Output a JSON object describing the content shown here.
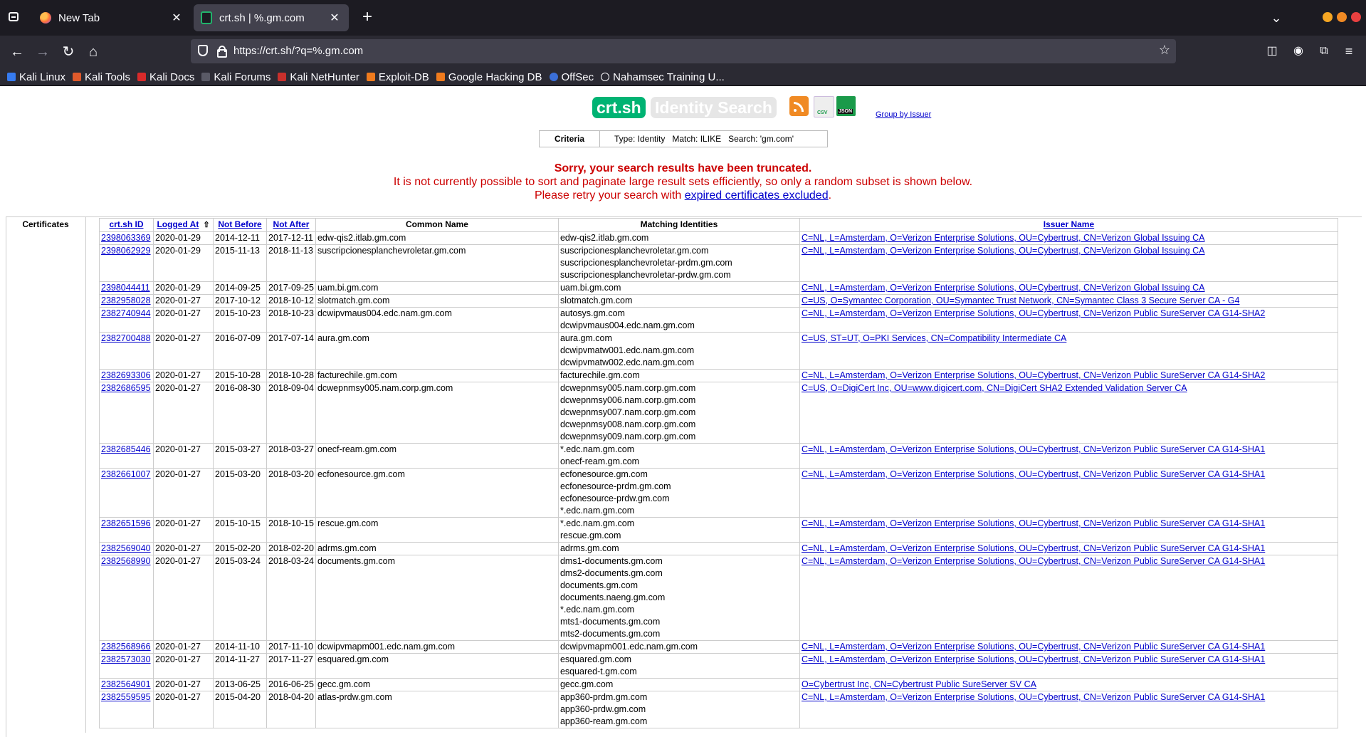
{
  "browser": {
    "tabs": [
      {
        "title": "New Tab",
        "active": false
      },
      {
        "title": "crt.sh | %.gm.com",
        "active": true
      }
    ],
    "url": "https://crt.sh/?q=%.gm.com",
    "bookmarks": [
      {
        "label": "Kali Linux",
        "icon": "kali-dragon-icon"
      },
      {
        "label": "Kali Tools",
        "icon": "kali-tools-icon"
      },
      {
        "label": "Kali Docs",
        "icon": "kali-docs-icon"
      },
      {
        "label": "Kali Forums",
        "icon": "kali-forums-icon"
      },
      {
        "label": "Kali NetHunter",
        "icon": "kali-nethunter-icon"
      },
      {
        "label": "Exploit-DB",
        "icon": "exploit-db-icon"
      },
      {
        "label": "Google Hacking DB",
        "icon": "ghdb-icon"
      },
      {
        "label": "OffSec",
        "icon": "offsec-icon"
      },
      {
        "label": "Nahamsec Training U...",
        "icon": "globe-icon"
      }
    ],
    "accent": "#1c1b22"
  },
  "page": {
    "logo": "crt.sh",
    "heading": "Identity Search",
    "group_by_issuer": "Group by Issuer",
    "criteria": {
      "label": "Criteria",
      "text": "Type: Identity   Match: ILIKE   Search: 'gm.com'"
    },
    "warning": {
      "line1": "Sorry, your search results have been truncated.",
      "line2": "It is not currently possible to sort and paginate large result sets efficiently, so only a random subset is shown below.",
      "line3_prefix": "Please retry your search with ",
      "line3_link": "expired certificates excluded",
      "line3_suffix": "."
    },
    "section_label": "Certificates",
    "columns": [
      "crt.sh ID",
      "Logged At",
      "Not Before",
      "Not After",
      "Common Name",
      "Matching Identities",
      "Issuer Name"
    ],
    "sort_indicator": "⇧",
    "rows": [
      {
        "id": "2398063369",
        "logged": "2020-01-29",
        "not_before": "2014-12-11",
        "not_after": "2017-12-11",
        "cn": "edw-qis2.itlab.gm.com",
        "identities": [
          "edw-qis2.itlab.gm.com"
        ],
        "issuer": "C=NL, L=Amsterdam, O=Verizon Enterprise Solutions, OU=Cybertrust, CN=Verizon Global Issuing CA"
      },
      {
        "id": "2398062929",
        "logged": "2020-01-29",
        "not_before": "2015-11-13",
        "not_after": "2018-11-13",
        "cn": "suscripcionesplanchevroletar.gm.com",
        "identities": [
          "suscripcionesplanchevroletar.gm.com",
          "suscripcionesplanchevroletar-prdm.gm.com",
          "suscripcionesplanchevroletar-prdw.gm.com"
        ],
        "issuer": "C=NL, L=Amsterdam, O=Verizon Enterprise Solutions, OU=Cybertrust, CN=Verizon Global Issuing CA"
      },
      {
        "id": "2398044411",
        "logged": "2020-01-29",
        "not_before": "2014-09-25",
        "not_after": "2017-09-25",
        "cn": "uam.bi.gm.com",
        "identities": [
          "uam.bi.gm.com"
        ],
        "issuer": "C=NL, L=Amsterdam, O=Verizon Enterprise Solutions, OU=Cybertrust, CN=Verizon Global Issuing CA"
      },
      {
        "id": "2382958028",
        "logged": "2020-01-27",
        "not_before": "2017-10-12",
        "not_after": "2018-10-12",
        "cn": "slotmatch.gm.com",
        "identities": [
          "slotmatch.gm.com"
        ],
        "issuer": "C=US, O=Symantec Corporation, OU=Symantec Trust Network, CN=Symantec Class 3 Secure Server CA - G4"
      },
      {
        "id": "2382740944",
        "logged": "2020-01-27",
        "not_before": "2015-10-23",
        "not_after": "2018-10-23",
        "cn": "dcwipvmaus004.edc.nam.gm.com",
        "identities": [
          "autosys.gm.com",
          "dcwipvmaus004.edc.nam.gm.com"
        ],
        "issuer": "C=NL, L=Amsterdam, O=Verizon Enterprise Solutions, OU=Cybertrust, CN=Verizon Public SureServer CA G14-SHA2"
      },
      {
        "id": "2382700488",
        "logged": "2020-01-27",
        "not_before": "2016-07-09",
        "not_after": "2017-07-14",
        "cn": "aura.gm.com",
        "identities": [
          "aura.gm.com",
          "dcwipvmatw001.edc.nam.gm.com",
          "dcwipvmatw002.edc.nam.gm.com"
        ],
        "issuer": "C=US, ST=UT, O=PKI Services, CN=Compatibility Intermediate CA"
      },
      {
        "id": "2382693306",
        "logged": "2020-01-27",
        "not_before": "2015-10-28",
        "not_after": "2018-10-28",
        "cn": "facturechile.gm.com",
        "identities": [
          "facturechile.gm.com"
        ],
        "issuer": "C=NL, L=Amsterdam, O=Verizon Enterprise Solutions, OU=Cybertrust, CN=Verizon Public SureServer CA G14-SHA2"
      },
      {
        "id": "2382686595",
        "logged": "2020-01-27",
        "not_before": "2016-08-30",
        "not_after": "2018-09-04",
        "cn": "dcwepnmsy005.nam.corp.gm.com",
        "identities": [
          "dcwepnmsy005.nam.corp.gm.com",
          "dcwepnmsy006.nam.corp.gm.com",
          "dcwepnmsy007.nam.corp.gm.com",
          "dcwepnmsy008.nam.corp.gm.com",
          "dcwepnmsy009.nam.corp.gm.com"
        ],
        "issuer": "C=US, O=DigiCert Inc, OU=www.digicert.com, CN=DigiCert SHA2 Extended Validation Server CA"
      },
      {
        "id": "2382685446",
        "logged": "2020-01-27",
        "not_before": "2015-03-27",
        "not_after": "2018-03-27",
        "cn": "onecf-ream.gm.com",
        "identities": [
          "*.edc.nam.gm.com",
          "onecf-ream.gm.com"
        ],
        "issuer": "C=NL, L=Amsterdam, O=Verizon Enterprise Solutions, OU=Cybertrust, CN=Verizon Public SureServer CA G14-SHA1"
      },
      {
        "id": "2382661007",
        "logged": "2020-01-27",
        "not_before": "2015-03-20",
        "not_after": "2018-03-20",
        "cn": "ecfonesource.gm.com",
        "identities": [
          "ecfonesource.gm.com",
          "ecfonesource-prdm.gm.com",
          "ecfonesource-prdw.gm.com",
          "*.edc.nam.gm.com"
        ],
        "issuer": "C=NL, L=Amsterdam, O=Verizon Enterprise Solutions, OU=Cybertrust, CN=Verizon Public SureServer CA G14-SHA1"
      },
      {
        "id": "2382651596",
        "logged": "2020-01-27",
        "not_before": "2015-10-15",
        "not_after": "2018-10-15",
        "cn": "rescue.gm.com",
        "identities": [
          "*.edc.nam.gm.com",
          "rescue.gm.com"
        ],
        "issuer": "C=NL, L=Amsterdam, O=Verizon Enterprise Solutions, OU=Cybertrust, CN=Verizon Public SureServer CA G14-SHA1"
      },
      {
        "id": "2382569040",
        "logged": "2020-01-27",
        "not_before": "2015-02-20",
        "not_after": "2018-02-20",
        "cn": "adrms.gm.com",
        "identities": [
          "adrms.gm.com"
        ],
        "issuer": "C=NL, L=Amsterdam, O=Verizon Enterprise Solutions, OU=Cybertrust, CN=Verizon Public SureServer CA G14-SHA1"
      },
      {
        "id": "2382568990",
        "logged": "2020-01-27",
        "not_before": "2015-03-24",
        "not_after": "2018-03-24",
        "cn": "documents.gm.com",
        "identities": [
          "dms1-documents.gm.com",
          "dms2-documents.gm.com",
          "documents.gm.com",
          "documents.naeng.gm.com",
          "*.edc.nam.gm.com",
          "mts1-documents.gm.com",
          "mts2-documents.gm.com"
        ],
        "issuer": "C=NL, L=Amsterdam, O=Verizon Enterprise Solutions, OU=Cybertrust, CN=Verizon Public SureServer CA G14-SHA1"
      },
      {
        "id": "2382568966",
        "logged": "2020-01-27",
        "not_before": "2014-11-10",
        "not_after": "2017-11-10",
        "cn": "dcwipvmapm001.edc.nam.gm.com",
        "identities": [
          "dcwipvmapm001.edc.nam.gm.com"
        ],
        "issuer": "C=NL, L=Amsterdam, O=Verizon Enterprise Solutions, OU=Cybertrust, CN=Verizon Public SureServer CA G14-SHA1"
      },
      {
        "id": "2382573030",
        "logged": "2020-01-27",
        "not_before": "2014-11-27",
        "not_after": "2017-11-27",
        "cn": "esquared.gm.com",
        "identities": [
          "esquared.gm.com",
          "esquared-t.gm.com"
        ],
        "issuer": "C=NL, L=Amsterdam, O=Verizon Enterprise Solutions, OU=Cybertrust, CN=Verizon Public SureServer CA G14-SHA1"
      },
      {
        "id": "2382564901",
        "logged": "2020-01-27",
        "not_before": "2013-06-25",
        "not_after": "2016-06-25",
        "cn": "gecc.gm.com",
        "identities": [
          "gecc.gm.com"
        ],
        "issuer": "O=Cybertrust Inc, CN=Cybertrust Public SureServer SV CA"
      },
      {
        "id": "2382559595",
        "logged": "2020-01-27",
        "not_before": "2015-04-20",
        "not_after": "2018-04-20",
        "cn": "atlas-prdw.gm.com",
        "identities": [
          "app360-prdm.gm.com",
          "app360-prdw.gm.com",
          "app360-ream.gm.com"
        ],
        "issuer": "C=NL, L=Amsterdam, O=Verizon Enterprise Solutions, OU=Cybertrust, CN=Verizon Public SureServer CA G14-SHA1"
      }
    ],
    "colors": {
      "logo_bg": "#00b373",
      "warning": "#cc0000",
      "link": "#0000cc"
    }
  }
}
